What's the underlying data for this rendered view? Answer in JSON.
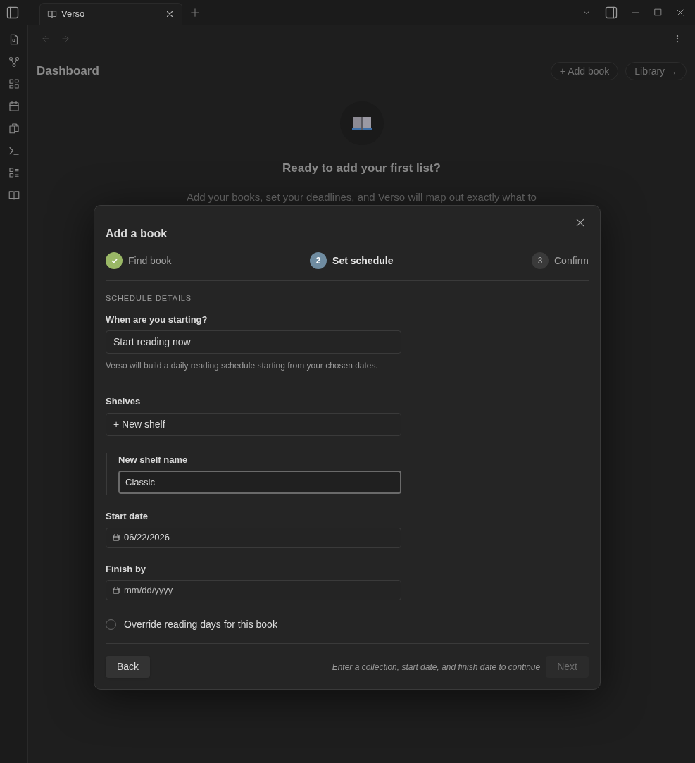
{
  "tab_bar": {
    "tabs": [
      {
        "label": "Verso",
        "selected": true
      }
    ]
  },
  "ribbon": {
    "items": [
      {
        "kind": "file-search"
      },
      {
        "kind": "graph"
      },
      {
        "kind": "grid"
      },
      {
        "kind": "calendar"
      },
      {
        "kind": "files"
      },
      {
        "kind": "terminal"
      },
      {
        "kind": "checklist"
      },
      {
        "kind": "book"
      }
    ]
  },
  "page": {
    "title": "Dashboard",
    "buttons": [
      "+ Add book",
      "Library →"
    ],
    "empty_state": {
      "title": "Ready to add your first list?",
      "text": "Add your books, set your deadlines, and Verso will map out exactly what to"
    }
  },
  "dialog": {
    "title": "Add a book",
    "steps": [
      {
        "label": "Find book",
        "done": true,
        "selected": false
      },
      {
        "number": "2",
        "label": "Set schedule",
        "done": false,
        "selected": true
      },
      {
        "number": "3",
        "label": "Confirm",
        "done": false,
        "selected": false
      }
    ],
    "section": "SCHEDULE DETAILS",
    "start": {
      "label": "When are you starting?",
      "value": "Start reading now",
      "hint": "Verso will build a daily reading schedule starting from your chosen dates."
    },
    "shelves": {
      "label": "Shelves",
      "value": "+ New shelf"
    },
    "new_shelf": {
      "label": "New shelf name",
      "value": "Classic",
      "focused": true
    },
    "start_date": {
      "label": "Start date",
      "value": "06/22/2026",
      "empty": false
    },
    "finish_date": {
      "label": "Finish by",
      "value": "mm/dd/yyyy",
      "empty": true
    },
    "override": {
      "label": "Override reading days for this book",
      "checked": false
    },
    "back": "Back",
    "footer_hint": "Enter a collection, start date, and finish date to continue",
    "next": {
      "label": "Next",
      "disabled": true
    }
  }
}
